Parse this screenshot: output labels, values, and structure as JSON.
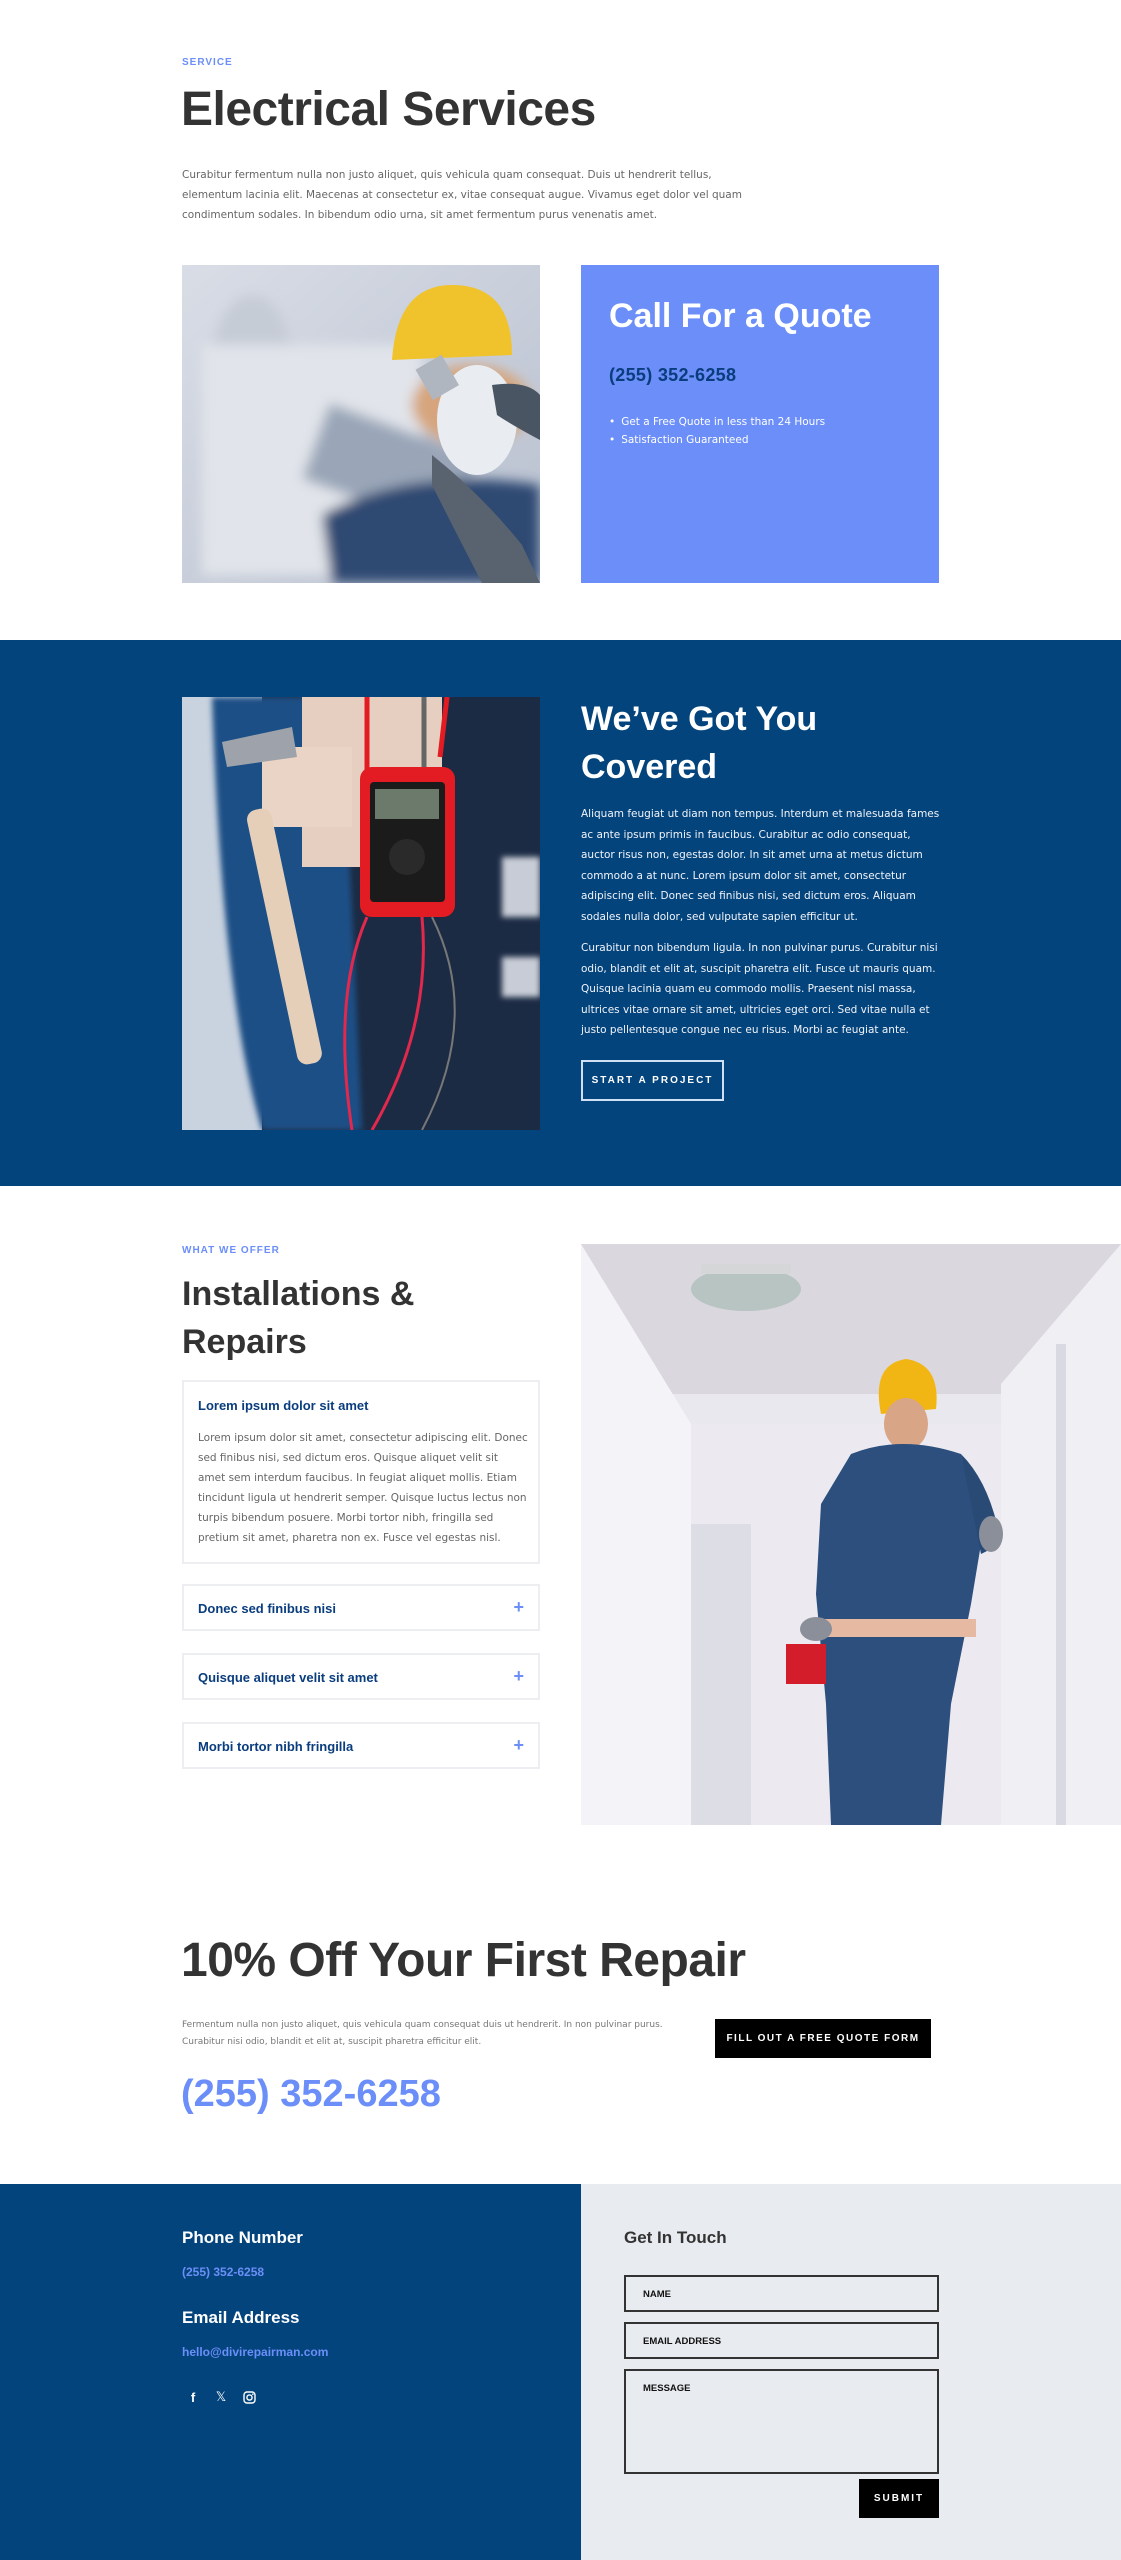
{
  "intro": {
    "eyebrow": "SERVICE",
    "title": "Electrical Services",
    "description": "Curabitur fermentum nulla non justo aliquet, quis vehicula quam consequat. Duis ut hendrerit tellus, elementum lacinia elit. Maecenas at consectetur ex, vitae consequat augue. Vivamus eget dolor vel quam condimentum sodales. In bibendum odio urna, sit amet fermentum purus venenatis amet.",
    "image_alt": "Electrician in yellow hard hat holding a light bulb"
  },
  "quote_box": {
    "title": "Call For a Quote",
    "phone": "(255) 352-6258",
    "bullets": [
      "Get a Free Quote in less than 24 Hours",
      "Satisfaction Guaranteed"
    ]
  },
  "covered": {
    "title": "We’ve Got You Covered",
    "paragraph1": "Aliquam feugiat ut diam non tempus. Interdum et malesuada fames ac ante ipsum primis in faucibus. Curabitur ac odio consequat, auctor risus non, egestas dolor. In sit amet urna at metus dictum commodo a at nunc. Lorem ipsum dolor sit amet, consectetur adipiscing elit. Donec sed finibus nisi, sed dictum eros. Aliquam sodales nulla dolor, sed vulputate sapien efficitur ut.",
    "paragraph2": "Curabitur non bibendum ligula. In non pulvinar purus. Curabitur nisi odio, blandit et elit at, suscipit pharetra elit. Fusce ut mauris quam. Quisque lacinia quam eu commodo mollis. Praesent nisl massa, ultrices vitae ornare sit amet, ultricies eget orci. Sed vitae nulla et justo pellentesque congue nec eu risus. Morbi ac feugiat ante.",
    "button_label": "START A PROJECT",
    "image_alt": "Red multimeter hanging from a tool belt"
  },
  "offer": {
    "eyebrow": "WHAT WE OFFER",
    "title": "Installations & Repairs",
    "accordion": [
      {
        "title": "Lorem ipsum dolor sit amet",
        "open": true,
        "body": "Lorem ipsum dolor sit amet, consectetur adipiscing elit. Donec sed finibus nisi, sed dictum eros. Quisque aliquet velit sit amet sem interdum faucibus. In feugiat aliquet mollis. Etiam tincidunt ligula ut hendrerit semper. Quisque luctus lectus non turpis bibendum posuere. Morbi tortor nibh, fringilla sed pretium sit amet, pharetra non ex. Fusce vel egestas nisl."
      },
      {
        "title": "Donec sed finibus nisi",
        "open": false,
        "icon": "+"
      },
      {
        "title": "Quisque aliquet velit sit amet",
        "open": false,
        "icon": "+"
      },
      {
        "title": "Morbi tortor nibh fringilla",
        "open": false,
        "icon": "+"
      }
    ],
    "image_alt": "Electrician in hard hat looking at ceiling light"
  },
  "promo": {
    "title": "10% Off Your First Repair",
    "description": "Fermentum nulla non justo aliquet, quis vehicula quam consequat duis ut hendrerit. In non pulvinar purus. Curabitur nisi odio, blandit et elit at, suscipit pharetra efficitur elit.",
    "button_label": "FILL OUT A FREE QUOTE FORM",
    "phone": "(255) 352-6258"
  },
  "footer": {
    "phone_heading": "Phone Number",
    "phone": "(255) 352-6258",
    "email_heading": "Email Address",
    "email": "hello@divirepairman.com",
    "social": [
      {
        "name": "facebook-icon",
        "glyph": "f"
      },
      {
        "name": "x-twitter-icon",
        "glyph": "𝕏"
      },
      {
        "name": "instagram-icon",
        "glyph": "◎"
      }
    ],
    "form": {
      "title": "Get In Touch",
      "name_placeholder": "NAME",
      "email_placeholder": "EMAIL ADDRESS",
      "message_placeholder": "MESSAGE",
      "submit_label": "SUBMIT"
    }
  },
  "colors": {
    "accent": "#6b8ef8",
    "navy": "#04447c",
    "dark_text": "#333333",
    "form_bg": "#e8ebef"
  }
}
